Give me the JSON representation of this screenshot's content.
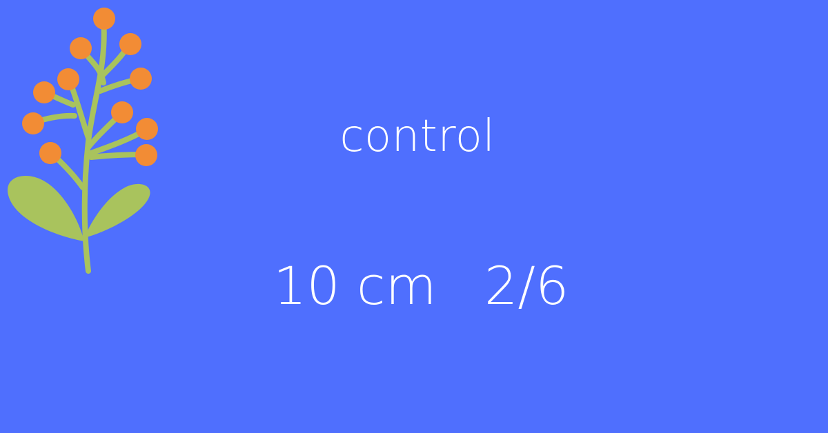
{
  "background_color": "#4f6ffe",
  "colors": {
    "stem": "#a9c35d",
    "berry": "#f28c35",
    "text": "#ffffff"
  },
  "illustration": "berry-branch-icon",
  "title": "control",
  "measurement": {
    "size": "10 cm",
    "ratio": "2/6"
  }
}
